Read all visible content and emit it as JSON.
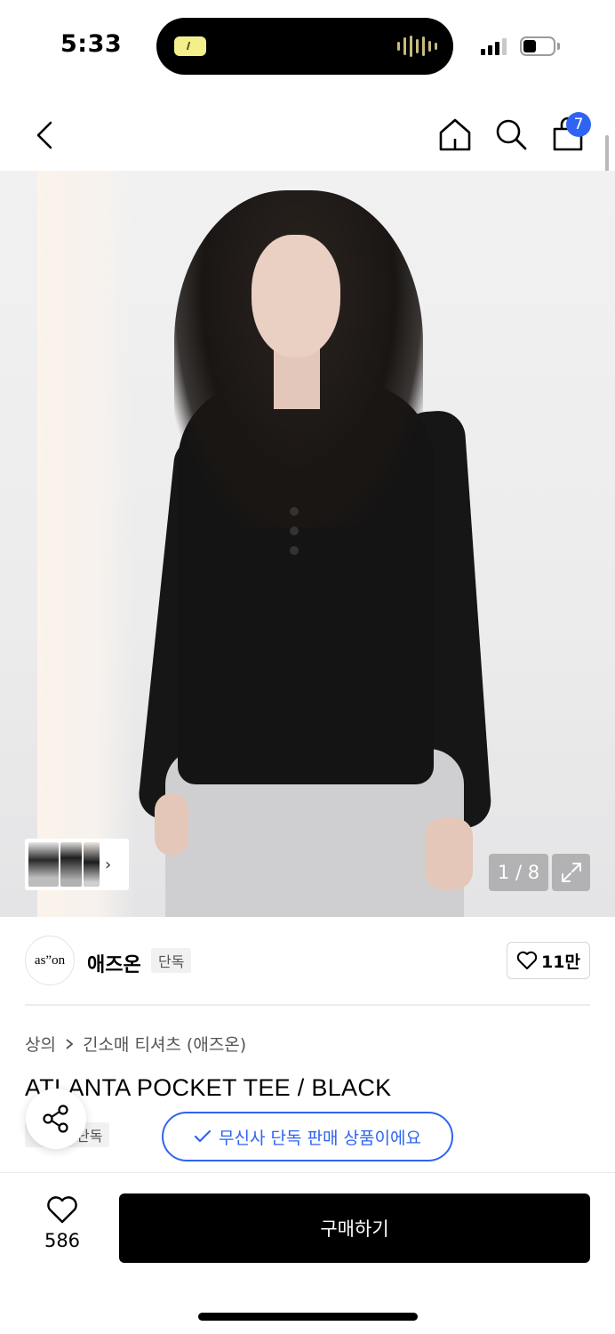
{
  "status_bar": {
    "time": "5:33"
  },
  "header": {
    "back_icon": "chevron-left-icon",
    "home_icon": "home-icon",
    "search_icon": "search-icon",
    "cart_icon": "shopping-bag-icon",
    "cart_count": "7"
  },
  "gallery": {
    "counter": "1 / 8",
    "current_image": 1,
    "total_images": 8,
    "expand_icon": "expand-icon",
    "thumb_arrow": "›"
  },
  "brand": {
    "logo_text": "as”on",
    "name": "애즈온",
    "tag": "단독",
    "like_count": "11만"
  },
  "product": {
    "breadcrumb": [
      "상의",
      "긴소매 티셔츠 (애즈온)"
    ],
    "title": "ATLANTA POCKET TEE / BLACK",
    "tag": "단독",
    "exclusive_notice": "무신사 단독 판매 상품이에요"
  },
  "bottom_bar": {
    "wish_count": "586",
    "buy_label": "구매하기"
  },
  "colors": {
    "accent_blue": "#2f64f2",
    "buy_button": "#000000"
  }
}
